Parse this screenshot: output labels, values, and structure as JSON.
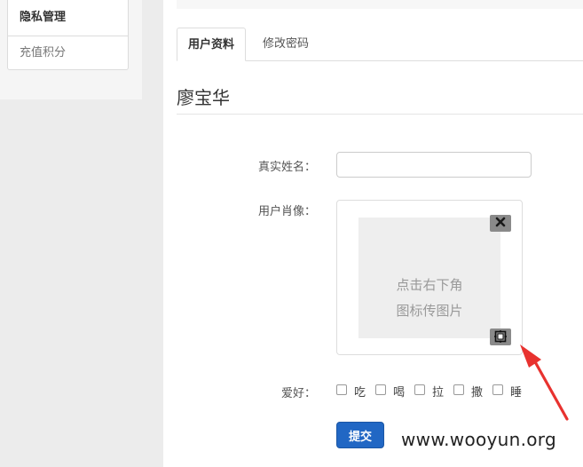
{
  "sidebar": {
    "items": [
      {
        "label": "隐私管理"
      },
      {
        "label": "充值积分"
      }
    ]
  },
  "tabs": [
    {
      "label": "用户资料"
    },
    {
      "label": "修改密码"
    }
  ],
  "profile": {
    "user_name": "廖宝华",
    "real_name_label": "真实姓名：",
    "real_name_value": "",
    "avatar_label": "用户肖像：",
    "upload_hint": "点击右下角\n图标传图片",
    "hobby_label": "爱好：",
    "hobbies": [
      {
        "label": "吃"
      },
      {
        "label": "喝"
      },
      {
        "label": "拉"
      },
      {
        "label": "撒"
      },
      {
        "label": "睡"
      }
    ],
    "submit_label": "提交"
  },
  "annotation": {
    "arrow_color": "#e8322f"
  },
  "watermark": "www.wooyun.org",
  "colors": {
    "primary_button": "#2167c4"
  }
}
